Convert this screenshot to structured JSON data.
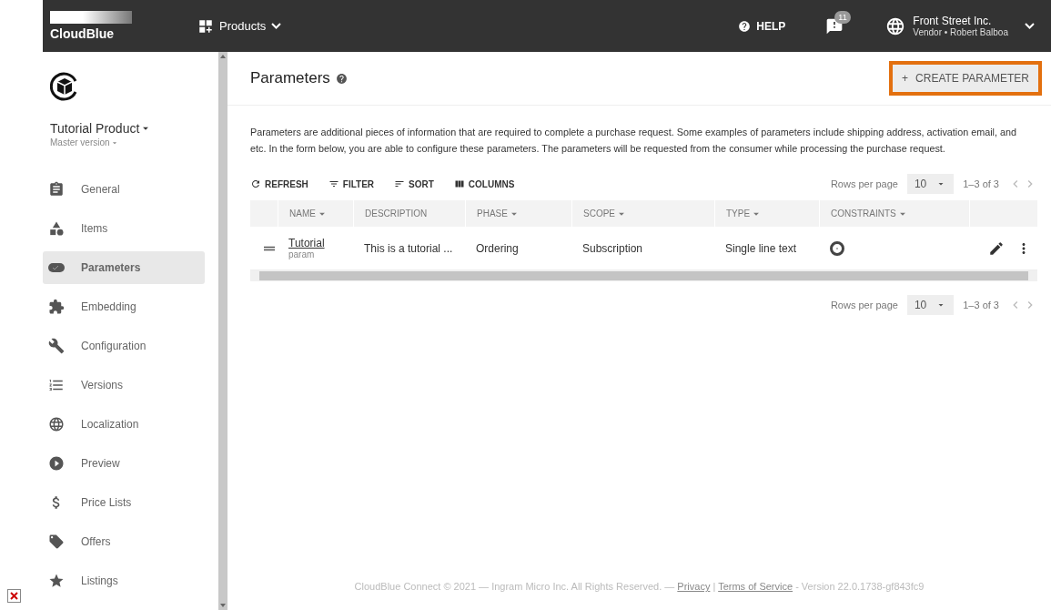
{
  "topbar": {
    "logo": "CloudBlue",
    "module": "Products",
    "help": "HELP",
    "notifications": "11",
    "account": {
      "name": "Front Street Inc.",
      "role": "Vendor • Robert Balboa"
    }
  },
  "sidebar": {
    "product": "Tutorial Product",
    "version": "Master version",
    "items": [
      {
        "label": "General",
        "kind": "clipboard",
        "selected": false
      },
      {
        "label": "Items",
        "kind": "shapes",
        "selected": false
      },
      {
        "label": "Parameters",
        "kind": "toggle",
        "selected": true
      },
      {
        "label": "Embedding",
        "kind": "puzzle",
        "selected": false
      },
      {
        "label": "Configuration",
        "kind": "wrench",
        "selected": false
      },
      {
        "label": "Versions",
        "kind": "list",
        "selected": false
      },
      {
        "label": "Localization",
        "kind": "globe",
        "selected": false
      },
      {
        "label": "Preview",
        "kind": "play",
        "selected": false
      },
      {
        "label": "Price Lists",
        "kind": "dollar",
        "selected": false
      },
      {
        "label": "Offers",
        "kind": "tag",
        "selected": false
      },
      {
        "label": "Listings",
        "kind": "star",
        "selected": false
      }
    ]
  },
  "page": {
    "title": "Parameters",
    "create_button": "CREATE PARAMETER",
    "create_icon": "+",
    "description": "Parameters are additional pieces of information that are required to complete a purchase request. Some examples of parameters include shipping address, activation email, and etc. In the form below, you are able to configure these parameters. The parameters will be requested from the consumer while processing the purchase request."
  },
  "toolbar": [
    {
      "label": "REFRESH",
      "kind": "refresh"
    },
    {
      "label": "FILTER",
      "kind": "filter"
    },
    {
      "label": "SORT",
      "kind": "sort"
    },
    {
      "label": "COLUMNS",
      "kind": "columns"
    }
  ],
  "pagination": [
    {
      "label": "Rows per page",
      "rows": "10",
      "range": "1–3 of 3"
    },
    {
      "label": "Rows per page",
      "rows": "10",
      "range": "1–3 of 3"
    }
  ],
  "table": {
    "columns": [
      {
        "label": "NAME",
        "sortable": true
      },
      {
        "label": "DESCRIPTION",
        "sortable": false
      },
      {
        "label": "PHASE",
        "sortable": true
      },
      {
        "label": "SCOPE",
        "sortable": true
      },
      {
        "label": "TYPE",
        "sortable": true
      },
      {
        "label": "CONSTRAINTS",
        "sortable": true
      }
    ],
    "rows": [
      {
        "name": "Tutorial",
        "sub": "param",
        "description": "This is a tutorial ...",
        "phase": "Ordering",
        "scope": "Subscription",
        "type": "Single line text"
      }
    ]
  },
  "footer": {
    "prefix": "CloudBlue Connect © 2021 — Ingram Micro Inc. All Rights Reserved. — ",
    "links": [
      "Privacy",
      "Terms of Service"
    ],
    "separator": " | ",
    "suffix": " - Version 22.0.1738-gf843fc9"
  }
}
